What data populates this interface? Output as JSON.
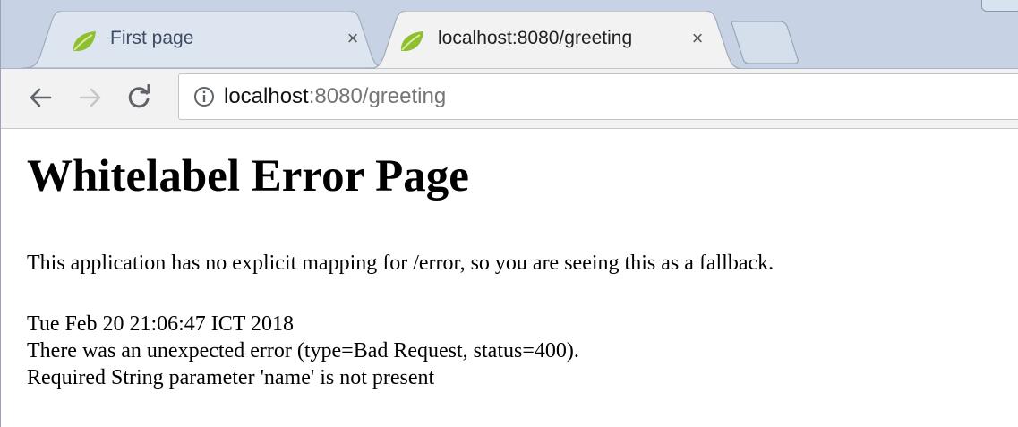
{
  "browser": {
    "tabs": [
      {
        "title": "First page",
        "close": "×",
        "active": false
      },
      {
        "title": "localhost:8080/greeting",
        "close": "×",
        "active": true
      }
    ],
    "toolbar": {
      "back_icon": "arrow-left-icon",
      "forward_icon": "arrow-right-icon",
      "reload_icon": "reload-icon",
      "url_host": "localhost",
      "url_rest": ":8080/greeting"
    },
    "colors": {
      "tabstrip": "#c7d3e5",
      "active_tab": "#f2f2f2",
      "favicon_leaf": "#8fbe2f"
    }
  },
  "page": {
    "heading": "Whitelabel Error Page",
    "message": "This application has no explicit mapping for /error, so you are seeing this as a fallback.",
    "timestamp": "Tue Feb 20 21:06:47 ICT 2018",
    "error_line": "There was an unexpected error (type=Bad Request, status=400).",
    "detail_line": "Required String parameter 'name' is not present"
  }
}
